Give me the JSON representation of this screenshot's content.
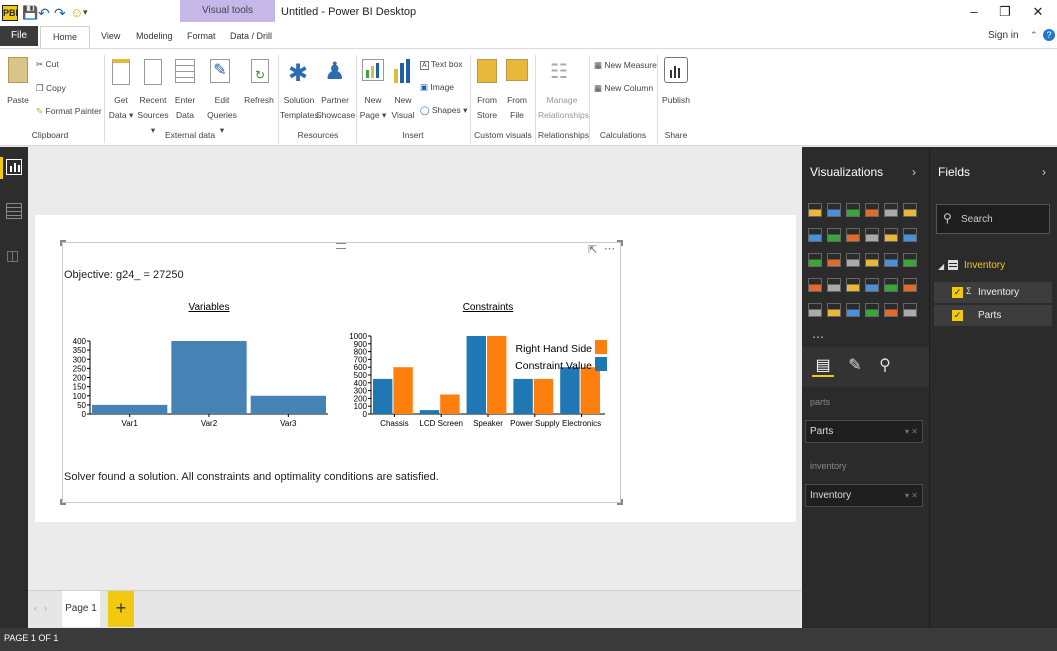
{
  "titlebar": {
    "logo": "PBI",
    "context_tab": "Visual tools",
    "title": "Untitled - Power BI Desktop"
  },
  "tabs": {
    "file": "File",
    "home": "Home",
    "view": "View",
    "modeling": "Modeling",
    "format": "Format",
    "data_drill": "Data / Drill",
    "sign_in": "Sign in"
  },
  "ribbon": {
    "clipboard": {
      "paste": "Paste",
      "cut": "Cut",
      "copy": "Copy",
      "format_painter": "Format Painter",
      "group": "Clipboard"
    },
    "external": {
      "get_data_1": "Get",
      "get_data_2": "Data",
      "recent_1": "Recent",
      "recent_2": "Sources",
      "enter_1": "Enter",
      "enter_2": "Data",
      "edit_1": "Edit",
      "edit_2": "Queries",
      "refresh": "Refresh",
      "group": "External data"
    },
    "resources": {
      "solution_1": "Solution",
      "solution_2": "Templates",
      "partner_1": "Partner",
      "partner_2": "Showcase",
      "group": "Resources"
    },
    "insert": {
      "new_page_1": "New",
      "new_page_2": "Page",
      "new_visual_1": "New",
      "new_visual_2": "Visual",
      "text_box": "Text box",
      "image": "Image",
      "shapes": "Shapes",
      "group": "Insert"
    },
    "custom": {
      "from_store_1": "From",
      "from_store_2": "Store",
      "from_file_1": "From",
      "from_file_2": "File",
      "group": "Custom visuals"
    },
    "relationships": {
      "manage_1": "Manage",
      "manage_2": "Relationships",
      "group": "Relationships"
    },
    "calculations": {
      "new_measure": "New Measure",
      "new_column": "New Column",
      "group": "Calculations"
    },
    "share": {
      "publish": "Publish",
      "group": "Share"
    }
  },
  "visual": {
    "objective": "Objective: g24_ = 27250",
    "message": "Solver found a solution. All constraints and optimality conditions are satisfied."
  },
  "chart_data": [
    {
      "type": "bar",
      "title": "Variables",
      "categories": [
        "Var1",
        "Var2",
        "Var3"
      ],
      "values": [
        50,
        400,
        100
      ],
      "ylim": [
        0,
        400
      ],
      "yticks": [
        0,
        50,
        100,
        150,
        200,
        250,
        300,
        350,
        400
      ],
      "colors": [
        "#4682b4"
      ]
    },
    {
      "type": "bar",
      "title": "Constraints",
      "categories": [
        "Chassis",
        "LCD Screen",
        "Speaker",
        "Power Supply",
        "Electronics"
      ],
      "series": [
        {
          "name": "Constraint Value",
          "values": [
            450,
            50,
            1000,
            450,
            600
          ],
          "color": "#1f77b4"
        },
        {
          "name": "Right Hand Side",
          "values": [
            600,
            250,
            1000,
            450,
            600
          ],
          "color": "#ff7f0e"
        }
      ],
      "ylim": [
        0,
        1000
      ],
      "yticks": [
        0,
        100,
        200,
        300,
        400,
        500,
        600,
        700,
        800,
        900,
        1000
      ],
      "legend": [
        "Right Hand Side",
        "Constraint Value"
      ]
    }
  ],
  "visualizations": {
    "title": "Visualizations",
    "well1_label": "parts",
    "well1_value": "Parts",
    "well2_label": "inventory",
    "well2_value": "Inventory"
  },
  "fields": {
    "title": "Fields",
    "search_placeholder": "Search",
    "table": "Inventory",
    "field1": "Inventory",
    "field2": "Parts"
  },
  "pages": {
    "page1": "Page 1",
    "add": "+"
  },
  "status": "PAGE 1 OF 1"
}
